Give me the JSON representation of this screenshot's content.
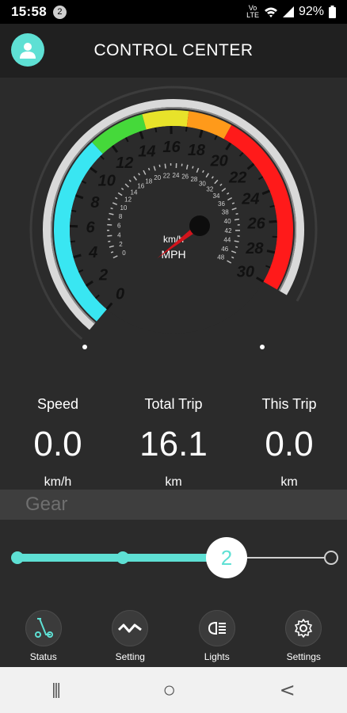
{
  "statusbar": {
    "time": "15:58",
    "notif_count": "2",
    "battery": "92%"
  },
  "header": {
    "title": "CONTROL CENTER",
    "icon": "user-icon"
  },
  "gauge": {
    "outer_labels": [
      "0",
      "2",
      "4",
      "6",
      "8",
      "10",
      "12",
      "14",
      "16",
      "18",
      "20",
      "22",
      "24",
      "26",
      "28",
      "30"
    ],
    "inner_labels": [
      "0",
      "2",
      "4",
      "6",
      "8",
      "10",
      "12",
      "14",
      "16",
      "18",
      "20",
      "22",
      "24",
      "26",
      "28",
      "30",
      "32",
      "34",
      "36",
      "38",
      "40",
      "42",
      "44",
      "46",
      "48"
    ],
    "unit_top": "km/h",
    "unit_bottom": "MPH",
    "needle_value_kmh": 0,
    "colors": {
      "cyan": "#39e6f2",
      "green": "#45d93a",
      "yellow": "#e8e32a",
      "red": "#ff1a1a",
      "needle": "#d1141c"
    }
  },
  "stats": [
    {
      "label": "Speed",
      "value": "0.0",
      "unit": "km/h"
    },
    {
      "label": "Total Trip",
      "value": "16.1",
      "unit": "km"
    },
    {
      "label": "This Trip",
      "value": "0.0",
      "unit": "km"
    }
  ],
  "gear": {
    "label": "Gear",
    "current": "2",
    "levels": 3,
    "accent": "#5ee0d4"
  },
  "nav": [
    {
      "label": "Status",
      "icon": "scooter-icon"
    },
    {
      "label": "Setting",
      "icon": "wave-icon"
    },
    {
      "label": "Lights",
      "icon": "headlight-icon"
    },
    {
      "label": "Settings",
      "icon": "gear-icon"
    }
  ],
  "sysnav": {
    "recent": "|||",
    "home": "○",
    "back": "<"
  }
}
